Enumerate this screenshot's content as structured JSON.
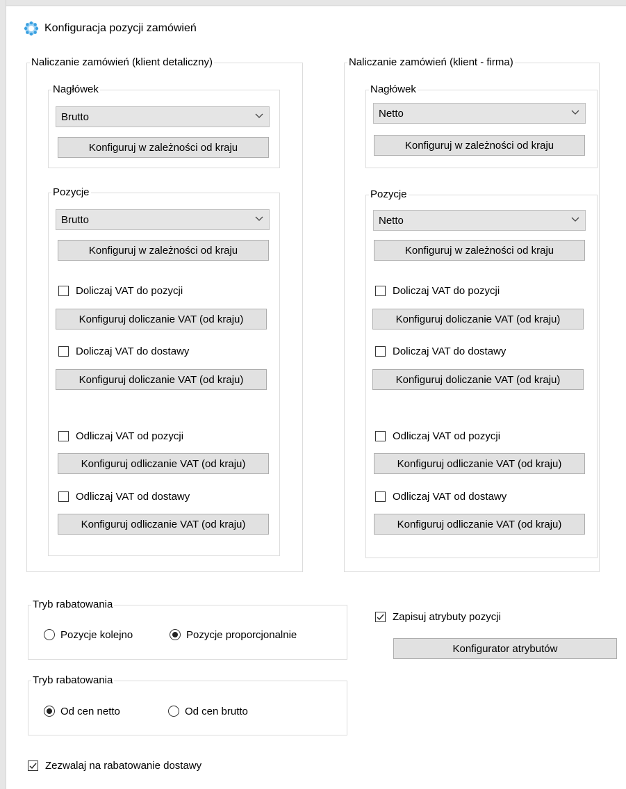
{
  "window": {
    "title": "Konfiguracja pozycji zamówień"
  },
  "retail": {
    "legend": "Naliczanie zamówień (klient detaliczny)",
    "header": {
      "legend": "Nagłówek",
      "select_value": "Brutto",
      "configure_button": "Konfiguruj w zależności od kraju"
    },
    "items": {
      "legend": "Pozycje",
      "select_value": "Brutto",
      "configure_button": "Konfiguruj w zależności od kraju",
      "add_vat_items": "Doliczaj VAT do pozycji",
      "add_vat_items_button": "Konfiguruj doliczanie VAT (od kraju)",
      "add_vat_delivery": "Doliczaj VAT do dostawy",
      "add_vat_delivery_button": "Konfiguruj doliczanie VAT (od kraju)",
      "sub_vat_items": "Odliczaj VAT od pozycji",
      "sub_vat_items_button": "Konfiguruj odliczanie VAT (od kraju)",
      "sub_vat_delivery": "Odliczaj VAT od dostawy",
      "sub_vat_delivery_button": "Konfiguruj odliczanie VAT (od kraju)"
    }
  },
  "company": {
    "legend": "Naliczanie zamówień (klient - firma)",
    "header": {
      "legend": "Nagłówek",
      "select_value": "Netto",
      "configure_button": "Konfiguruj w zależności od kraju"
    },
    "items": {
      "legend": "Pozycje",
      "select_value": "Netto",
      "configure_button": "Konfiguruj w zależności od kraju",
      "add_vat_items": "Doliczaj VAT do pozycji",
      "add_vat_items_button": "Konfiguruj doliczanie VAT (od kraju)",
      "add_vat_delivery": "Doliczaj VAT do dostawy",
      "add_vat_delivery_button": "Konfiguruj doliczanie VAT (od kraju)",
      "sub_vat_items": "Odliczaj VAT od pozycji",
      "sub_vat_items_button": "Konfiguruj odliczanie VAT (od kraju)",
      "sub_vat_delivery": "Odliczaj VAT od dostawy",
      "sub_vat_delivery_button": "Konfiguruj odliczanie VAT (od kraju)"
    }
  },
  "discount_mode_1": {
    "legend": "Tryb rabatowania",
    "option_sequential": "Pozycje kolejno",
    "option_proportional": "Pozycje proporcjonalnie",
    "selected": "Pozycje proporcjonalnie"
  },
  "discount_mode_2": {
    "legend": "Tryb rabatowania",
    "option_net": "Od cen netto",
    "option_gross": "Od cen brutto",
    "selected": "Od cen netto"
  },
  "save_attributes": {
    "label": "Zapisuj atrybuty pozycji",
    "checked": true,
    "button": "Konfigurator atrybutów"
  },
  "allow_delivery_discount": {
    "label": "Zezwalaj na rabatowanie dostawy",
    "checked": true
  },
  "colors": {
    "button_bg": "#e1e1e1",
    "border": "#dcdcdc",
    "icon_blue": "#3aa0e0"
  }
}
